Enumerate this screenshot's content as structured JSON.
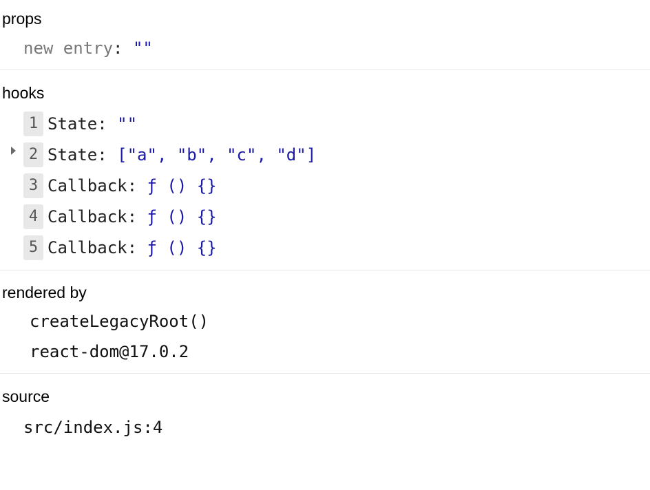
{
  "props": {
    "title": "props",
    "entry": {
      "key": "new entry",
      "sep": ": ",
      "value": "\"\""
    }
  },
  "hooks": {
    "title": "hooks",
    "items": [
      {
        "index": "1",
        "name": "State",
        "sep": ": ",
        "value": "\"\""
      },
      {
        "index": "2",
        "name": "State",
        "sep": ": ",
        "value": "[\"a\", \"b\", \"c\", \"d\"]",
        "expandable": true
      },
      {
        "index": "3",
        "name": "Callback",
        "sep": ": ",
        "value": "ƒ () {}"
      },
      {
        "index": "4",
        "name": "Callback",
        "sep": ": ",
        "value": "ƒ () {}"
      },
      {
        "index": "5",
        "name": "Callback",
        "sep": ": ",
        "value": "ƒ () {}"
      }
    ]
  },
  "rendered_by": {
    "title": "rendered by",
    "items": [
      "createLegacyRoot()",
      "react-dom@17.0.2"
    ]
  },
  "source": {
    "title": "source",
    "value": "src/index.js:4"
  },
  "colors": {
    "value_blue": "#1a1aa6",
    "muted_key": "#777777",
    "badge_bg": "#e8e8e8",
    "divider": "#e6e6e6"
  }
}
